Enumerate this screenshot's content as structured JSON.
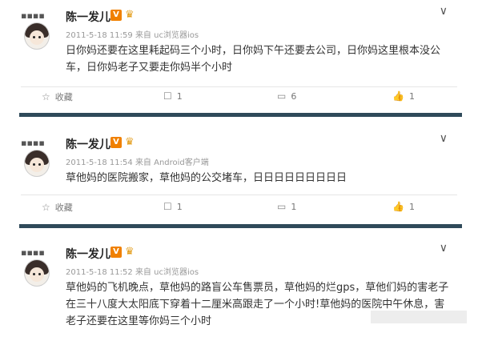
{
  "posts": [
    {
      "username": "陈一发儿",
      "badge_v": "V",
      "badge_crown": "♛",
      "time": "2011-5-18 11:59",
      "source": "来自 uc浏览器ios",
      "chevron": "∨",
      "content": "日你妈还要在这里耗起码三个小时，日你妈下午还要去公司，日你妈这里根本没公车，日你妈老子又要走你妈半个小时",
      "actions": {
        "fav": "收藏",
        "repost": "1",
        "comment": "6",
        "like": "1"
      }
    },
    {
      "username": "陈一发儿",
      "badge_v": "V",
      "badge_crown": "♛",
      "time": "2011-5-18 11:54",
      "source": "来自 Android客户端",
      "chevron": "∨",
      "content": "草他妈的医院搬家，草他妈的公交堵车，日日日日日日日日日",
      "actions": {
        "fav": "收藏",
        "repost": "1",
        "comment": "1",
        "like": "1"
      }
    },
    {
      "username": "陈一发儿",
      "badge_v": "V",
      "badge_crown": "♛",
      "time": "2011-5-18 11:52",
      "source": "来自 uc浏览器ios",
      "chevron": "∨",
      "content": "草他妈的飞机晚点，草他妈的路盲公车售票员，草他妈的烂gps，草他们妈的害老子在三十八度大太阳底下穿着十二厘米高跟走了一个小时!草他妈的医院中午休息，害老子还要在这里等你妈三个小时"
    }
  ],
  "icons": {
    "star": "☆",
    "repost": "☐",
    "comment": "▭",
    "like": "👍",
    "avatar_dots": "▪▪▪▪"
  }
}
